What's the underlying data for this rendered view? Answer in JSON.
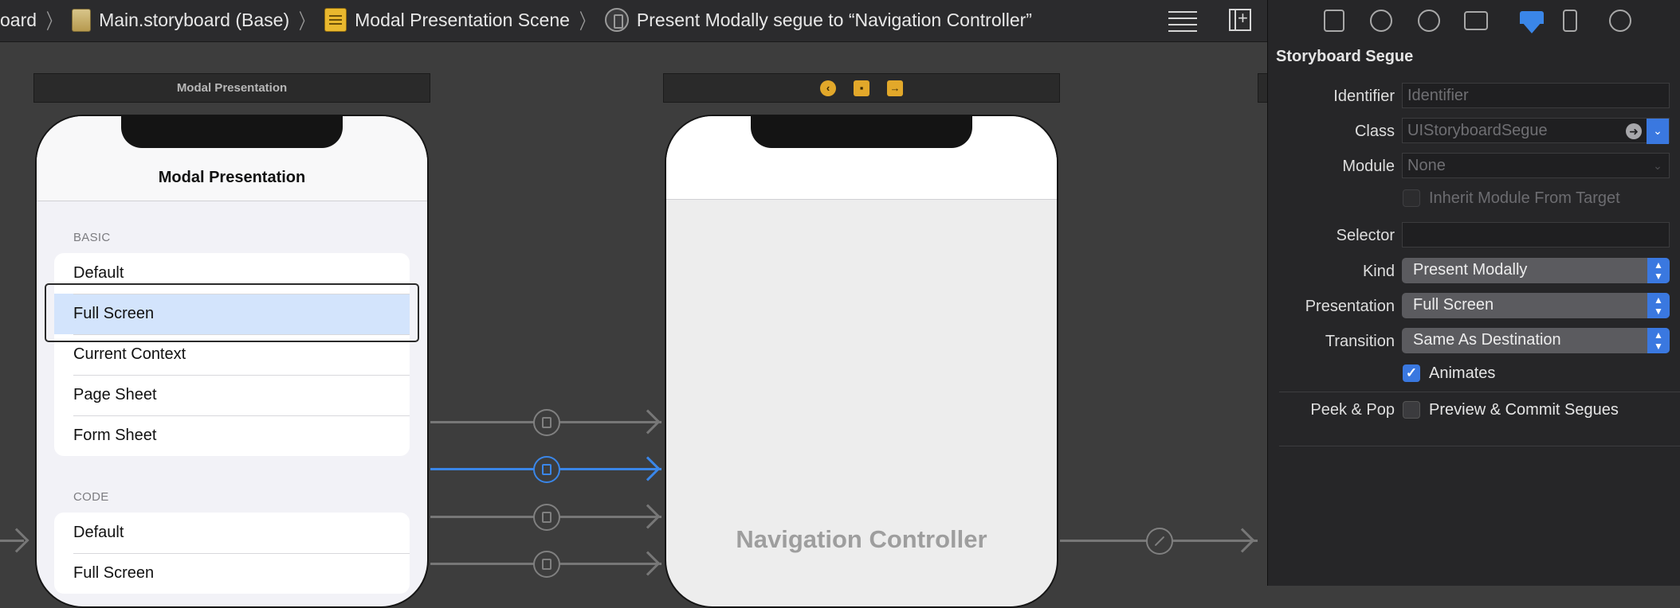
{
  "breadcrumb": {
    "items": [
      "oard",
      "Main.storyboard (Base)",
      "Modal Presentation Scene",
      "Present Modally segue to “Navigation Controller”"
    ]
  },
  "canvas": {
    "scene1": {
      "dock_title": "Modal Presentation",
      "nav_title": "Modal Presentation",
      "sections": [
        {
          "header": "BASIC",
          "rows": [
            "Default",
            "Full Screen",
            "Current Context",
            "Page Sheet",
            "Form Sheet"
          ],
          "selected_index": 1
        },
        {
          "header": "CODE",
          "rows": [
            "Default",
            "Full Screen"
          ]
        }
      ]
    },
    "scene2": {
      "dock_icons": [
        "back-circle-icon",
        "cube-icon",
        "exit-icon"
      ],
      "label": "Navigation Controller"
    },
    "segues": {
      "count": 4,
      "selected_index": 1
    },
    "relationship_segue_icon": "relationship-icon",
    "colors": {
      "selection": "#3a86e8",
      "segue": "#777777"
    }
  },
  "inspector": {
    "tabs": [
      "file-icon",
      "history-icon",
      "help-icon",
      "identity-icon",
      "attributes-icon",
      "size-icon",
      "connections-icon"
    ],
    "active_tab": "attributes-icon",
    "title": "Storyboard Segue",
    "identifier": {
      "label": "Identifier",
      "placeholder": "Identifier"
    },
    "class": {
      "label": "Class",
      "value": "UIStoryboardSegue"
    },
    "module": {
      "label": "Module",
      "value": "None"
    },
    "inherit_module": {
      "label": "Inherit Module From Target",
      "checked": false
    },
    "selector": {
      "label": "Selector",
      "value": ""
    },
    "kind": {
      "label": "Kind",
      "value": "Present Modally"
    },
    "presentation": {
      "label": "Presentation",
      "value": "Full Screen"
    },
    "transition": {
      "label": "Transition",
      "value": "Same As Destination"
    },
    "animates": {
      "label": "Animates",
      "checked": true
    },
    "peek_pop": {
      "label": "Peek & Pop",
      "option_label": "Preview & Commit Segues",
      "checked": false
    }
  }
}
